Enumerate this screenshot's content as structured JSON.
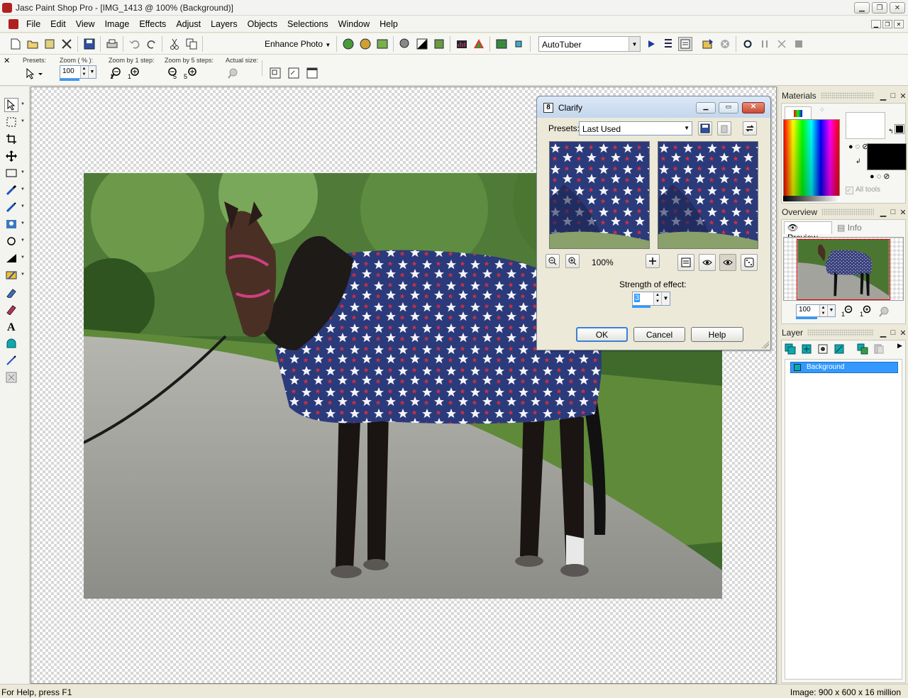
{
  "window": {
    "title": "Jasc Paint Shop Pro - [IMG_1413 @ 100% (Background)]"
  },
  "menu": [
    "File",
    "Edit",
    "View",
    "Image",
    "Effects",
    "Adjust",
    "Layers",
    "Objects",
    "Selections",
    "Window",
    "Help"
  ],
  "toolbar": {
    "enhance_photo": "Enhance Photo",
    "script_name": "AutoTuber"
  },
  "tool_options": {
    "presets_label": "Presets:",
    "zoom_label": "Zoom ( % ):",
    "zoom_value": "100",
    "zoom_by_1_label": "Zoom by 1 step:",
    "zoom_by_5_label": "Zoom by 5 steps:",
    "actual_size_label": "Actual size:"
  },
  "dialog": {
    "title": "Clarify",
    "title_icon": "8",
    "presets_label": "Presets:",
    "preset_value": "Last Used",
    "zoom_value": "100%",
    "strength_label": "Strength of effect:",
    "strength_value": "3",
    "ok": "OK",
    "cancel": "Cancel",
    "help": "Help"
  },
  "palettes": {
    "materials": {
      "title": "Materials",
      "all_tools": "All tools"
    },
    "overview": {
      "title": "Overview",
      "tab_preview": "Preview",
      "tab_info": "Info",
      "zoom_value": "100"
    },
    "layer": {
      "title": "Layer",
      "layers": [
        "Background"
      ]
    }
  },
  "status": {
    "help": "For Help, press F1",
    "image_info": "Image:  900 x 600 x 16 million"
  },
  "colors": {
    "selection_blue": "#3399ff",
    "blanket_navy": "#2b3a7a",
    "ok_focus": "#3c7fd9"
  },
  "icons": {
    "tools": [
      "pick-tool-icon",
      "selection-tool-icon",
      "crop-tool-icon",
      "move-tool-icon",
      "rect-select-icon",
      "dropper-icon",
      "paint-brush-icon",
      "clone-brush-icon",
      "shape-icon",
      "dodge-icon",
      "color-replacer-icon",
      "eraser-icon",
      "background-eraser-icon",
      "text-tool-icon",
      "preset-shape-icon",
      "pen-tool-icon",
      "warp-brush-icon"
    ]
  }
}
